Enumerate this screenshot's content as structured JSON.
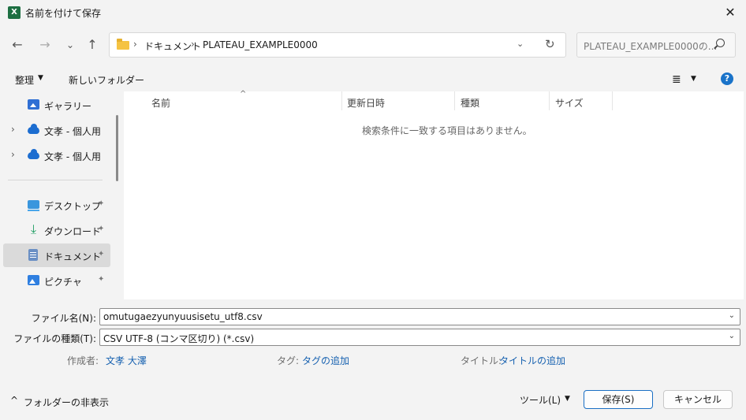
{
  "window": {
    "title": "名前を付けて保存",
    "app_icon": "X"
  },
  "nav": {
    "back": "←",
    "forward": "→",
    "recent": "⌄",
    "up": "↑"
  },
  "address": {
    "sep": "›",
    "crumbs": [
      "ドキュメント",
      "PLATEAU_EXAMPLE0000"
    ],
    "dropdown": "⌄",
    "refresh": "↻"
  },
  "search": {
    "placeholder": "PLATEAU_EXAMPLE0000の..."
  },
  "toolbar": {
    "organize": "整理",
    "new_folder": "新しいフォルダー",
    "view_icon": "≣",
    "caret": "▼",
    "help": "?"
  },
  "sidebar": {
    "items": [
      {
        "label": "ギャラリー",
        "icon": "gallery-icon"
      },
      {
        "label": "文孝 - 個人用",
        "icon": "onedrive-icon",
        "chevron": "›"
      },
      {
        "label": "文孝 - 個人用",
        "icon": "onedrive-icon",
        "chevron": "›"
      },
      {
        "label": "デスクトップ",
        "icon": "desktop-icon",
        "pin": "📌"
      },
      {
        "label": "ダウンロード",
        "icon": "download-icon",
        "pin": "📌"
      },
      {
        "label": "ドキュメント",
        "icon": "documents-icon",
        "pin": "📌",
        "selected": true
      },
      {
        "label": "ピクチャ",
        "icon": "pictures-icon",
        "pin": "📌"
      }
    ]
  },
  "filelist": {
    "columns": [
      "名前",
      "更新日時",
      "種類",
      "サイズ"
    ],
    "sort_caret": "^",
    "empty_message": "検索条件に一致する項目はありません。"
  },
  "form": {
    "filename_label": "ファイル名(N):",
    "filename_value": "omutugaezyunyuusisetu_utf8.csv",
    "filetype_label": "ファイルの種類(T):",
    "filetype_value": "CSV UTF-8 (コンマ区切り) (*.csv)",
    "author_label": "作成者:",
    "author_value": "文孝 大澤",
    "tags_label": "タグ:",
    "tags_value": "タグの追加",
    "title_label": "タイトル:",
    "title_value": "タイトルの追加"
  },
  "footer": {
    "hide_folders": "フォルダーの非表示",
    "hide_caret": "^",
    "tools": "ツール(L)",
    "save": "保存(S)",
    "cancel": "キャンセル"
  }
}
